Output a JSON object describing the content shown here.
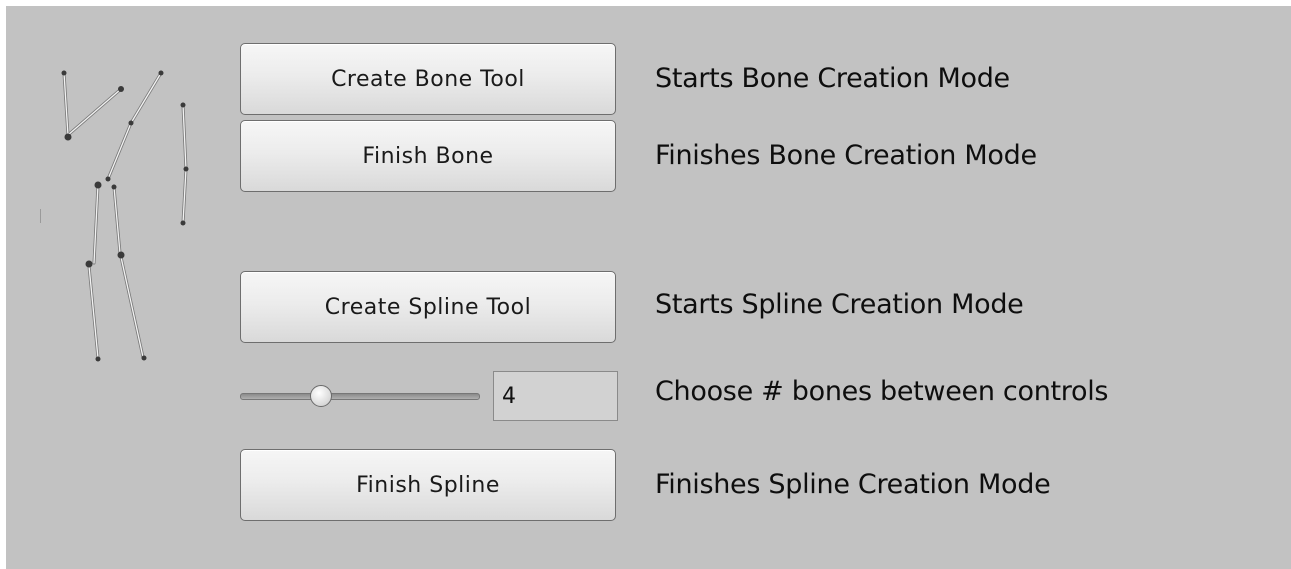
{
  "buttons": {
    "create_bone": "Create Bone Tool",
    "finish_bone": "Finish Bone",
    "create_spline": "Create Spline Tool",
    "finish_spline": "Finish Spline"
  },
  "descriptions": {
    "create_bone": "Starts Bone Creation Mode",
    "finish_bone": "Finishes Bone Creation Mode",
    "create_spline": "Starts Spline Creation Mode",
    "bone_count": "Choose # bones between controls",
    "finish_spline": "Finishes Spline Creation Mode"
  },
  "bone_count": {
    "value": "4"
  },
  "icons": {
    "skeleton": "skeleton-illustration-icon"
  },
  "colors": {
    "panel_background": "#c2c2c2",
    "button_border": "#6e6e6e"
  }
}
